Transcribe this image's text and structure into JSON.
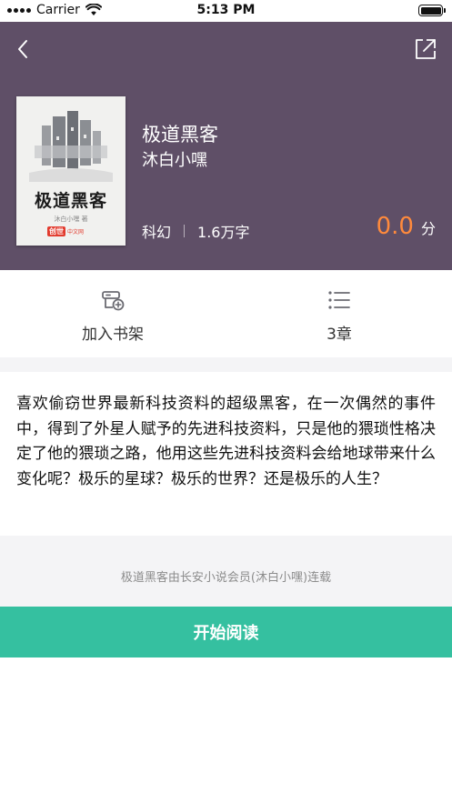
{
  "status_bar": {
    "carrier": "Carrier",
    "time": "5:13 PM"
  },
  "header": {
    "background_color": "#5f4f67",
    "back_icon": "chevron-left-icon",
    "share_icon": "share-icon"
  },
  "book": {
    "cover": {
      "title": "极道黑客",
      "author": "沐白小嘿 著",
      "publisher_mark": "创世",
      "publisher_text": "中文网"
    },
    "title": "极道黑客",
    "author": "沐白小嘿",
    "category": "科幻",
    "word_count": "1.6万字",
    "rating_value": "0.0",
    "rating_unit": "分",
    "rating_color": "#ff8a3c"
  },
  "actions": {
    "add_to_shelf": {
      "icon": "bookshelf-add-icon",
      "label": "加入书架"
    },
    "chapters": {
      "icon": "list-icon",
      "label": "3章"
    }
  },
  "intro": {
    "text": "喜欢偷窃世界最新科技资料的超级黑客，在一次偶然的事件中，得到了外星人赋予的先进科技资料，只是他的猥琐性格决定了他的猥琐之路，他用这些先进科技资料会给地球带来什么变化呢？极乐的星球？极乐的世界？还是极乐的人生？"
  },
  "credit": {
    "text": "极道黑客由长安小说会员(沐白小嘿)连载"
  },
  "start_button": {
    "label": "开始阅读",
    "color": "#35c0a0"
  }
}
